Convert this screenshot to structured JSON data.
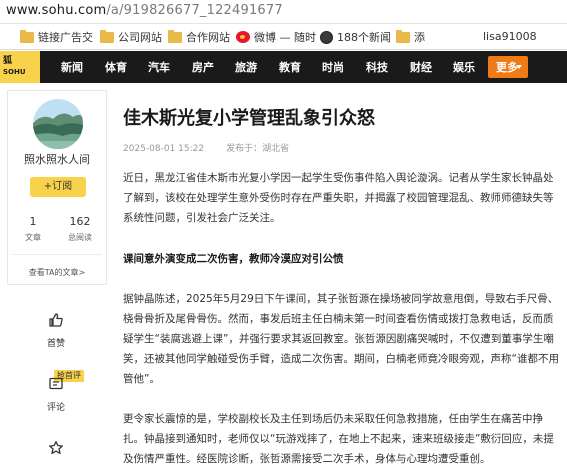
{
  "browser": {
    "url_host": "www.sohu.com",
    "url_path": "/a/919826677_122491677",
    "bookmarks": [
      "链接广告交",
      "公司网站",
      "合作网站",
      "微博 — 随时",
      "188个新闻",
      "添"
    ],
    "user": "lisa91008"
  },
  "nav": {
    "logo_top": "狐",
    "logo_bottom": "SOHU",
    "items": [
      "新闻",
      "体育",
      "汽车",
      "房产",
      "旅游",
      "教育",
      "时尚",
      "科技",
      "财经",
      "娱乐"
    ],
    "more": "更多"
  },
  "author": {
    "name": "照水照水人间",
    "follow": "+订阅",
    "articles_count": "1",
    "articles_label": "文章",
    "reads_count": "162",
    "reads_label": "总阅读",
    "view_link": "查看TA的文章>"
  },
  "actions": {
    "like": "首赞",
    "comment_badge": "抢首评",
    "comment": "评论"
  },
  "article": {
    "title": "佳木斯光复小学管理乱象引众怒",
    "date": "2025-08-01 15:22",
    "published": "发布于：湖北省",
    "p1": "近日，黑龙江省佳木斯市光复小学因一起学生受伤事件陷入舆论漩涡。记者从学生家长钟晶处了解到，该校在处理学生意外受伤时存在严重失职，并揭露了校园管理混乱、教师师德缺失等系统性问题，引发社会广泛关注。",
    "subhead": "课间意外演变成二次伤害，教师冷漠应对引公愤",
    "p2": "据钟晶陈述，2025年5月29日下午课间，其子张哲源在操场被同学故意甩倒，导致右手尺骨、桡骨骨折及尾骨骨伤。然而，事发后班主任白楠未第一时间查看伤情或拨打急救电话，反而质疑学生“装腐逃避上课”，并强行要求其返回教室。张哲源因剧痛哭喊时，不仅遭到董事学生嘲笑，还被其他同学触碰受伤手臂，造成二次伤害。期间，白楠老师竟冷眼旁观，声称“谁都不用管他”。",
    "p3": "更令家长震惊的是，学校副校长及主任到场后仍未采取任何急救措施，任由学生在痛苦中挣扎。钟晶接到通知时，老师仅以“玩游戏摔了，在地上不起来，速来班级接走”敷衍回应，未提及伤情严重性。经医院诊断，张哲源需接受二次手术，身体与心理均遭受重创。"
  }
}
